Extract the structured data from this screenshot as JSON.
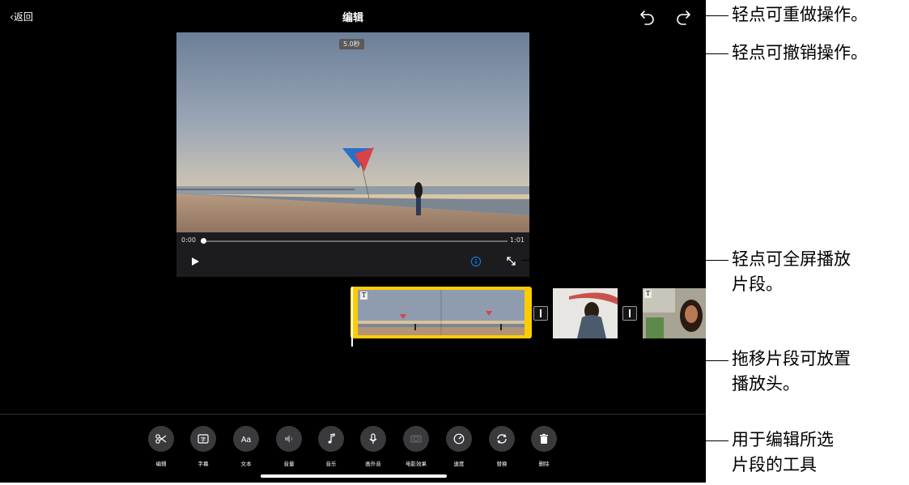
{
  "nav": {
    "back_label": "返回",
    "title": "编辑"
  },
  "viewer": {
    "duration_badge": "5.0秒",
    "current_time": "0:00",
    "end_time": "1:01",
    "playhead_progress": 0
  },
  "toolbar": {
    "tools": [
      {
        "label": "编辑",
        "icon": "scissors-icon"
      },
      {
        "label": "字幕",
        "icon": "captions-icon"
      },
      {
        "label": "文本",
        "icon": "text-icon"
      },
      {
        "label": "音量",
        "icon": "volume-icon"
      },
      {
        "label": "音乐",
        "icon": "music-icon"
      },
      {
        "label": "画外音",
        "icon": "microphone-icon"
      },
      {
        "label": "电影效果",
        "icon": "cinematic-icon"
      },
      {
        "label": "速度",
        "icon": "speed-icon"
      },
      {
        "label": "替换",
        "icon": "replace-icon"
      },
      {
        "label": "删除",
        "icon": "trash-icon"
      }
    ]
  },
  "callouts": {
    "redo": "轻点可重做操作。",
    "undo": "轻点可撤销操作。",
    "fullscreen_line1": "轻点可全屏播放",
    "fullscreen_line2": "片段。",
    "drag_line1": "拖移片段可放置",
    "drag_line2": "播放头。",
    "tools_line1": "用于编辑所选",
    "tools_line2": "片段的工具"
  },
  "colors": {
    "selection": "#ffcc00",
    "accent": "#0a84ff",
    "background": "#000000",
    "tool_button": "#3a3a3c"
  }
}
